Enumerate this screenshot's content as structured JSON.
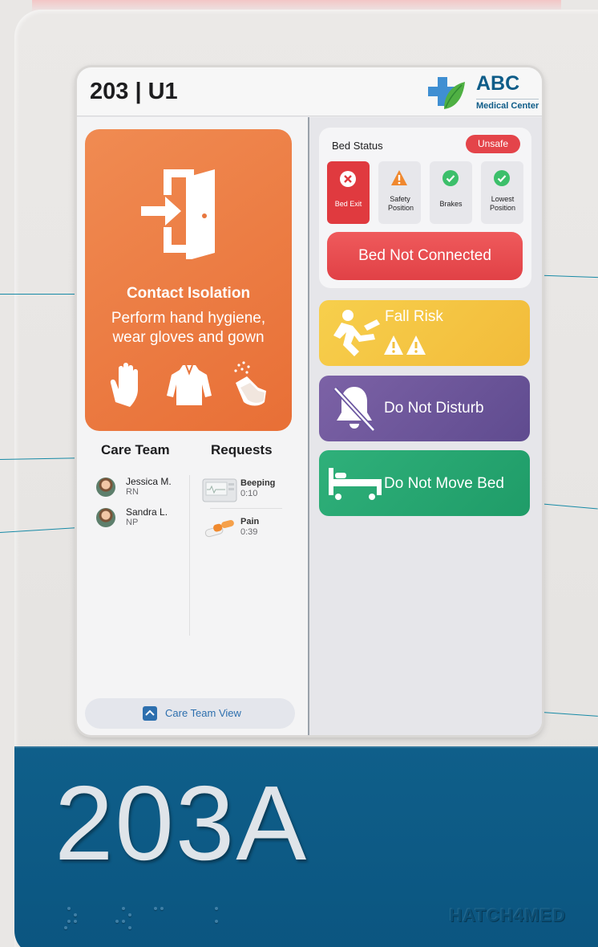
{
  "header": {
    "room": "203 | U1"
  },
  "logo": {
    "name": "ABC",
    "subtitle": "Medical Center",
    "icon": "medical-cross-leaf-icon"
  },
  "isolation": {
    "title": "Contact Isolation",
    "line1": "Perform hand hygiene,",
    "line2": "wear gloves and gown",
    "icons": [
      "door-exit-icon",
      "hand-glove-icon",
      "gown-icon",
      "hand-wash-icon"
    ],
    "color": "#e9773f"
  },
  "care_team": {
    "heading": "Care Team",
    "members": [
      {
        "name": "Jessica M.",
        "role": "RN"
      },
      {
        "name": "Sandra L.",
        "role": "NP"
      }
    ]
  },
  "requests": {
    "heading": "Requests",
    "items": [
      {
        "label": "Beeping",
        "time": "0:10",
        "icon": "monitor-icon"
      },
      {
        "label": "Pain",
        "time": "0:39",
        "icon": "pills-icon"
      }
    ]
  },
  "footer": {
    "view_button": "Care Team View",
    "icon": "chevron-up-icon"
  },
  "bed_status": {
    "title": "Bed Status",
    "badge": "Unsafe",
    "tiles": [
      {
        "label": "Bed Exit",
        "state": "alert",
        "icon": "x-circle-icon"
      },
      {
        "label": "Safety Position",
        "state": "warning",
        "icon": "warning-triangle-icon"
      },
      {
        "label": "Brakes",
        "state": "ok",
        "icon": "check-circle-icon"
      },
      {
        "label": "Lowest Position",
        "state": "ok",
        "icon": "check-circle-icon"
      }
    ],
    "connection": "Bed Not Connected"
  },
  "alerts": {
    "fall": {
      "label": "Fall Risk",
      "icon": "falling-person-icon",
      "color": "#f5c843"
    },
    "dnd": {
      "label": "Do Not Disturb",
      "icon": "bell-off-icon",
      "color": "#6d579b"
    },
    "move": {
      "label": "Do Not Move Bed",
      "icon": "bed-icon",
      "color": "#28a571"
    }
  },
  "sign": {
    "room_number": "203A",
    "brand": "HATCH4MED"
  }
}
